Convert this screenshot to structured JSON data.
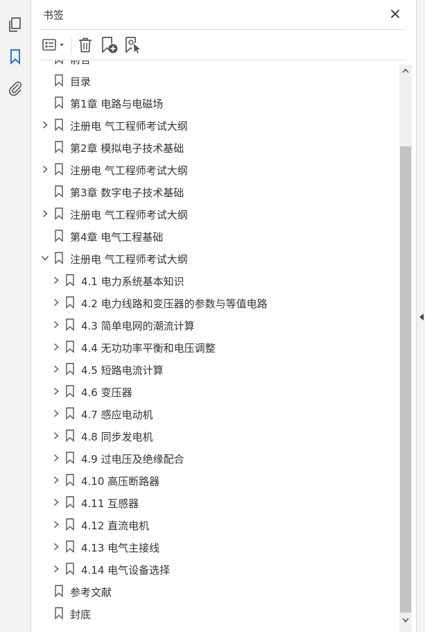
{
  "panel": {
    "title": "书签"
  },
  "icons": {
    "rail": [
      "pages-icon",
      "bookmark-icon",
      "paperclip-icon"
    ],
    "toolbar": [
      "options-menu-icon",
      "delete-icon",
      "new-bookmark-icon",
      "new-bookmark-from-structure-icon"
    ],
    "close": "close-icon"
  },
  "colors": {
    "accent": "#2d6fc7",
    "icon": "#555555",
    "text": "#333333",
    "scroll_thumb": "#c2c2c2"
  },
  "bookmarks": [
    {
      "label": "前言",
      "level": 0,
      "expander": "none"
    },
    {
      "label": "目录",
      "level": 0,
      "expander": "none"
    },
    {
      "label": "第1章 电路与电磁场",
      "level": 0,
      "expander": "none"
    },
    {
      "label": "注册电 气工程师考试大纲",
      "level": 0,
      "expander": "collapsed"
    },
    {
      "label": "第2章 模拟电子技术基础",
      "level": 0,
      "expander": "none"
    },
    {
      "label": "注册电 气工程师考试大纲",
      "level": 0,
      "expander": "collapsed"
    },
    {
      "label": "第3章 数字电子技术基础",
      "level": 0,
      "expander": "none"
    },
    {
      "label": "注册电 气工程师考试大纲",
      "level": 0,
      "expander": "collapsed"
    },
    {
      "label": "第4章 电气工程基础",
      "level": 0,
      "expander": "none"
    },
    {
      "label": "注册电 气工程师考试大纲",
      "level": 0,
      "expander": "expanded"
    },
    {
      "label": "4.1 电力系统基本知识",
      "level": 1,
      "expander": "collapsed"
    },
    {
      "label": "4.2 电力线路和变压器的参数与等值电路",
      "level": 1,
      "expander": "collapsed"
    },
    {
      "label": "4.3 简单电网的潮流计算",
      "level": 1,
      "expander": "collapsed"
    },
    {
      "label": "4.4 无功功率平衡和电压调整",
      "level": 1,
      "expander": "collapsed"
    },
    {
      "label": "4.5 短路电流计算",
      "level": 1,
      "expander": "collapsed"
    },
    {
      "label": "4.6 变压器",
      "level": 1,
      "expander": "collapsed"
    },
    {
      "label": "4.7 感应电动机",
      "level": 1,
      "expander": "collapsed"
    },
    {
      "label": "4.8 同步发电机",
      "level": 1,
      "expander": "collapsed"
    },
    {
      "label": "4.9 过电压及绝缘配合",
      "level": 1,
      "expander": "collapsed"
    },
    {
      "label": "4.10 高压断路器",
      "level": 1,
      "expander": "collapsed"
    },
    {
      "label": "4.11 互感器",
      "level": 1,
      "expander": "collapsed"
    },
    {
      "label": "4.12 直流电机",
      "level": 1,
      "expander": "collapsed"
    },
    {
      "label": "4.13 电气主接线",
      "level": 1,
      "expander": "collapsed"
    },
    {
      "label": "4.14 电气设备选择",
      "level": 1,
      "expander": "collapsed"
    },
    {
      "label": "参考文献",
      "level": 0,
      "expander": "none"
    },
    {
      "label": "封底",
      "level": 0,
      "expander": "none"
    }
  ]
}
